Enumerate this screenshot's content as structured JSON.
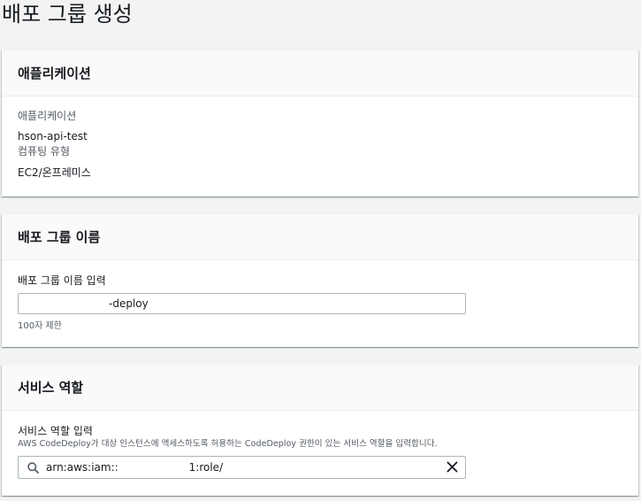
{
  "page": {
    "title": "배포 그룹 생성"
  },
  "application_panel": {
    "header": "애플리케이션",
    "app_label": "애플리케이션",
    "app_value": "hson-api-test",
    "compute_label": "컴퓨팅 유형",
    "compute_value": "EC2/온프레미스"
  },
  "group_name_panel": {
    "header": "배포 그룹 이름",
    "input_label": "배포 그룹 이름 입력",
    "input_value": "-deploy",
    "hint": "100자 제한"
  },
  "service_role_panel": {
    "header": "서비스 역할",
    "input_label": "서비스 역할 입력",
    "description": "AWS CodeDeploy가 대상 인스턴스에 액세스하도록 허용하는 CodeDeploy 권한이 있는 서비스 역할을 입력합니다.",
    "input_value_prefix": "arn:aws:iam::",
    "input_value_suffix": "1:role/"
  },
  "icons": {
    "search": "search-icon",
    "clear": "close-icon"
  }
}
